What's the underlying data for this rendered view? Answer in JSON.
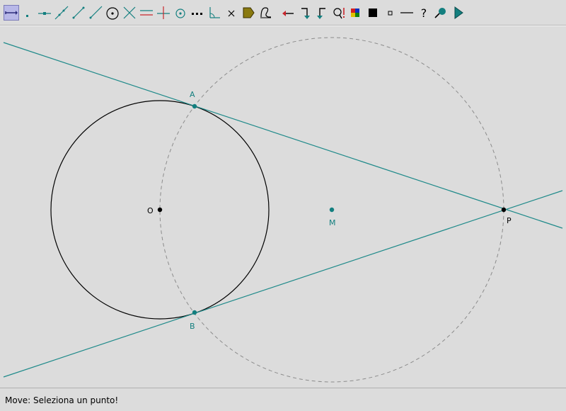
{
  "toolbar": {
    "tools": [
      {
        "name": "move-tool",
        "icon": "move-arrow-icon",
        "active": true
      },
      {
        "name": "point-tool",
        "icon": "point-icon"
      },
      {
        "name": "point-on-line-tool",
        "icon": "point-on-line-icon"
      },
      {
        "name": "line-tool",
        "icon": "line-icon"
      },
      {
        "name": "segment-tool",
        "icon": "segment-icon"
      },
      {
        "name": "ray-tool",
        "icon": "ray-icon"
      },
      {
        "name": "circle-tool",
        "icon": "circle-icon"
      },
      {
        "name": "intersection-tool",
        "icon": "intersection-icon"
      },
      {
        "name": "parallel-tool",
        "icon": "parallel-icon"
      },
      {
        "name": "perpendicular-tool",
        "icon": "perpendicular-icon"
      },
      {
        "name": "midpoint-tool",
        "icon": "midpoint-icon"
      },
      {
        "name": "dotted-line-tool",
        "icon": "dotted-line-icon"
      },
      {
        "name": "angle-tool",
        "icon": "angle-icon"
      },
      {
        "name": "delete-tool",
        "icon": "delete-x-icon"
      },
      {
        "name": "polygon-fill-tool",
        "icon": "polygon-fill-icon"
      },
      {
        "name": "label-tool",
        "icon": "label-icon"
      },
      {
        "name": "undo-tool",
        "icon": "left-arrow-icon"
      },
      {
        "name": "redo-tool",
        "icon": "redo-arrow-icon"
      },
      {
        "name": "back-tool",
        "icon": "back-arrow-icon"
      },
      {
        "name": "search-tool",
        "icon": "magnifier-icon"
      },
      {
        "name": "color-tool",
        "icon": "color-palette-icon"
      },
      {
        "name": "fill-tool",
        "icon": "black-square-icon"
      },
      {
        "name": "small-point-tool",
        "icon": "small-square-icon"
      },
      {
        "name": "line-style-tool",
        "icon": "line-style-icon"
      },
      {
        "name": "help-tool",
        "icon": "question-icon"
      },
      {
        "name": "zoom-tool",
        "icon": "zoom-icon"
      },
      {
        "name": "play-tool",
        "icon": "play-icon"
      }
    ]
  },
  "geometry": {
    "colors": {
      "construction": "#1f8a8a",
      "circle": "#000000",
      "dashed_circle": "#8c8c8c",
      "point_teal": "#137f7f",
      "point_black": "#000000"
    },
    "labels": {
      "A": "A",
      "B": "B",
      "O": "O",
      "M": "M",
      "P": "P"
    }
  },
  "status": {
    "text": "Move: Seleziona un punto!"
  }
}
